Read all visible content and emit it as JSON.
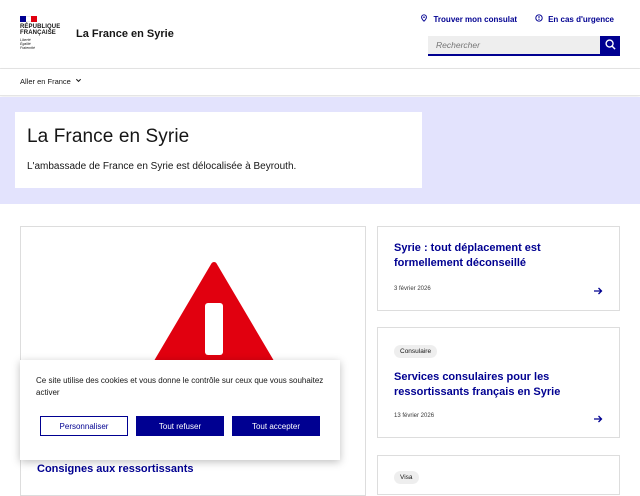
{
  "header": {
    "logo_lines": [
      "RÉPUBLIQUE",
      "FRANÇAISE"
    ],
    "logo_motto": [
      "Liberté",
      "Égalité",
      "Fraternité"
    ],
    "site_title": "La France en Syrie",
    "tools": [
      {
        "label": "Trouver mon consulat",
        "icon": "map-pin-icon"
      },
      {
        "label": "En cas d'urgence",
        "icon": "alert-circle-icon"
      }
    ],
    "search": {
      "placeholder": "Rechercher",
      "icon": "search-icon"
    }
  },
  "nav": {
    "items": [
      {
        "label": "Aller en France",
        "icon": "chevron-down-icon"
      }
    ]
  },
  "hero": {
    "title": "La France en Syrie",
    "subtitle": "L'ambassade de France en Syrie est délocalisée à Beyrouth."
  },
  "featured": {
    "image": "warning-triangle",
    "title": "Consignes aux ressortissants"
  },
  "news": [
    {
      "title": "Syrie : tout déplacement est formellement déconseillé",
      "date": "3 février 2026",
      "tag": ""
    },
    {
      "title": "Services consulaires pour les ressortissants français en Syrie",
      "date": "13 février 2026",
      "tag": "Consulaire"
    },
    {
      "title": "",
      "date": "",
      "tag": "Visa"
    }
  ],
  "cookie": {
    "text": "Ce site utilise des cookies et vous donne le contrôle sur ceux que vous souhaitez activer",
    "customize": "Personnaliser",
    "refuse": "Tout refuser",
    "accept": "Tout accepter"
  },
  "colors": {
    "primary": "#000091",
    "hero_bg": "#e3e3fd",
    "warning_red": "#e1000f"
  }
}
